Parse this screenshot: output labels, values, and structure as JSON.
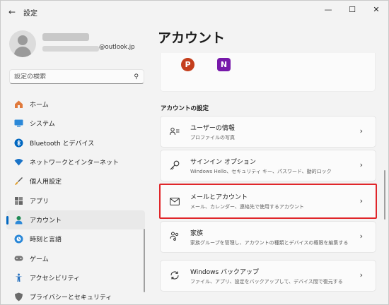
{
  "window": {
    "title": "設定",
    "back_icon": "arrow-left-icon"
  },
  "profile": {
    "email_domain": "@outlook.jp"
  },
  "search": {
    "placeholder": "設定の検索"
  },
  "sidebar": {
    "items": [
      {
        "label": "ホーム",
        "icon": "home-icon",
        "color": "#e07a3c"
      },
      {
        "label": "システム",
        "icon": "monitor-icon",
        "color": "#0067c0"
      },
      {
        "label": "Bluetooth とデバイス",
        "icon": "bluetooth-icon",
        "color": "#0067c0"
      },
      {
        "label": "ネットワークとインターネット",
        "icon": "wifi-icon",
        "color": "#1a73c7"
      },
      {
        "label": "個人用設定",
        "icon": "brush-icon",
        "color": "#444444"
      },
      {
        "label": "アプリ",
        "icon": "apps-icon",
        "color": "#555555"
      },
      {
        "label": "アカウント",
        "icon": "person-icon",
        "color": "#1f8a55",
        "active": true
      },
      {
        "label": "時刻と言語",
        "icon": "globe-clock-icon",
        "color": "#0067c0"
      },
      {
        "label": "ゲーム",
        "icon": "gamepad-icon",
        "color": "#777777"
      },
      {
        "label": "アクセシビリティ",
        "icon": "accessibility-icon",
        "color": "#2a73c0"
      },
      {
        "label": "プライバシーとセキュリティ",
        "icon": "shield-icon",
        "color": "#555555"
      }
    ]
  },
  "main": {
    "title": "アカウント",
    "apps": [
      {
        "letter": "P",
        "name": "PowerPoint",
        "color": "#c43e1c"
      },
      {
        "letter": "N",
        "name": "OneNote",
        "color": "#7719aa"
      }
    ],
    "section_heading": "アカウントの設定",
    "cards": [
      {
        "title": "ユーザーの情報",
        "subtitle": "プロファイルの写真",
        "icon": "user-info-icon"
      },
      {
        "title": "サインイン オプション",
        "subtitle": "Windows Hello、セキュリティ キー、パスワード、動的ロック",
        "icon": "key-icon"
      },
      {
        "title": "メールとアカウント",
        "subtitle": "メール、カレンダー、連絡先で使用するアカウント",
        "icon": "mail-icon",
        "highlighted": true
      },
      {
        "title": "家族",
        "subtitle": "家族グループを管理し、アカウントの種類とデバイスの権限を編集する",
        "icon": "family-icon"
      },
      {
        "title": "Windows バックアップ",
        "subtitle": "ファイル、アプリ、設定をバックアップして、デバイス間で復元する",
        "icon": "sync-icon"
      }
    ]
  },
  "colors": {
    "accent": "#0067c0",
    "highlight_border": "#e0262a"
  }
}
